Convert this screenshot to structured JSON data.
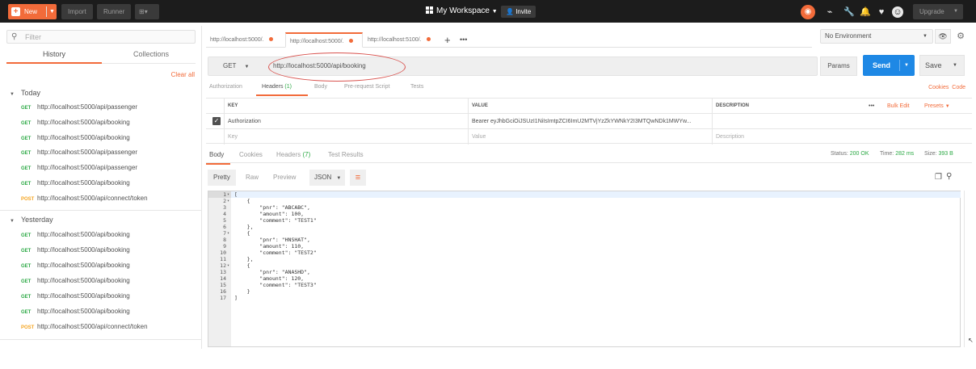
{
  "topbar": {
    "new_label": "New",
    "import_label": "Import",
    "runner_label": "Runner",
    "workspace_label": "My Workspace",
    "invite_label": "Invite",
    "upgrade_label": "Upgrade"
  },
  "sidebar": {
    "filter_placeholder": "Filter",
    "tab_history": "History",
    "tab_collections": "Collections",
    "clear_all": "Clear all",
    "groups": [
      {
        "title": "Today",
        "items": [
          {
            "method": "GET",
            "url": "http://localhost:5000/api/passenger"
          },
          {
            "method": "GET",
            "url": "http://localhost:5000/api/booking"
          },
          {
            "method": "GET",
            "url": "http://localhost:5000/api/booking"
          },
          {
            "method": "GET",
            "url": "http://localhost:5000/api/passenger"
          },
          {
            "method": "GET",
            "url": "http://localhost:5000/api/passenger"
          },
          {
            "method": "GET",
            "url": "http://localhost:5000/api/booking"
          },
          {
            "method": "POST",
            "url": "http://localhost:5000/api/connect/token"
          }
        ]
      },
      {
        "title": "Yesterday",
        "items": [
          {
            "method": "GET",
            "url": "http://localhost:5000/api/booking"
          },
          {
            "method": "GET",
            "url": "http://localhost:5000/api/booking"
          },
          {
            "method": "GET",
            "url": "http://localhost:5000/api/booking"
          },
          {
            "method": "GET",
            "url": "http://localhost:5000/api/booking"
          },
          {
            "method": "GET",
            "url": "http://localhost:5000/api/booking"
          },
          {
            "method": "GET",
            "url": "http://localhost:5000/api/booking"
          },
          {
            "method": "POST",
            "url": "http://localhost:5000/api/connect/token"
          }
        ]
      }
    ]
  },
  "tabs": [
    {
      "label": "http://localhost:5000/."
    },
    {
      "label": "http://localhost:5000/."
    },
    {
      "label": "http://localhost:5100/."
    }
  ],
  "environment": "No Environment",
  "request": {
    "method": "GET",
    "url": "http://localhost:5000/api/booking",
    "params_label": "Params",
    "send_label": "Send",
    "save_label": "Save"
  },
  "request_tabs": {
    "authorization": "Authorization",
    "headers": "Headers",
    "headers_count": "(1)",
    "body": "Body",
    "prerequest": "Pre-request Script",
    "tests": "Tests",
    "cookies": "Cookies",
    "code": "Code"
  },
  "headers_table": {
    "col_key": "KEY",
    "col_value": "VALUE",
    "col_description": "DESCRIPTION",
    "bulk_edit": "Bulk Edit",
    "presets": "Presets",
    "row_key": "Authorization",
    "row_value": "Bearer eyJhbGciOiJSUzI1NiIsImtpZCI6ImU2MTVjYzZkYWNkY2I3MTQwNDk1MWYw...",
    "placeholder_key": "Key",
    "placeholder_value": "Value",
    "placeholder_description": "Description"
  },
  "response": {
    "tab_body": "Body",
    "tab_cookies": "Cookies",
    "tab_headers": "Headers",
    "headers_count": "(7)",
    "tab_tests": "Test Results",
    "status_label": "Status:",
    "status_value": "200 OK",
    "time_label": "Time:",
    "time_value": "282 ms",
    "size_label": "Size:",
    "size_value": "393 B",
    "view_pretty": "Pretty",
    "view_raw": "Raw",
    "view_preview": "Preview",
    "format": "JSON"
  },
  "body_lines": [
    "[",
    "    {",
    "        \"pnr\": \"ABCABC\",",
    "        \"amount\": 100,",
    "        \"comment\": \"TEST1\"",
    "    },",
    "    {",
    "        \"pnr\": \"HNSHAT\",",
    "        \"amount\": 110,",
    "        \"comment\": \"TEST2\"",
    "    },",
    "    {",
    "        \"pnr\": \"ANASHD\",",
    "        \"amount\": 120,",
    "        \"comment\": \"TEST3\"",
    "    }",
    "]"
  ],
  "colors": {
    "accent": "#f26b3a",
    "send_blue": "#1e88e5",
    "get_green": "#2aa843",
    "post_orange": "#f5a623",
    "annotation_red": "#d9534f"
  }
}
